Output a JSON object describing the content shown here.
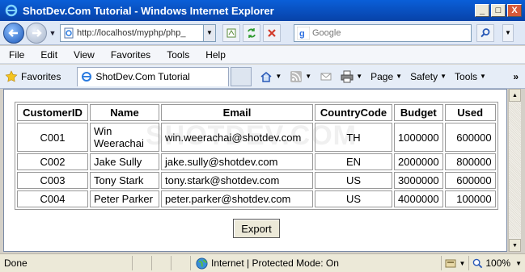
{
  "window": {
    "title": "ShotDev.Com Tutorial - Windows Internet Explorer",
    "controls": [
      "_",
      "□",
      "X"
    ]
  },
  "address": {
    "url": "http://localhost/myphp/php_",
    "search_placeholder": "Google"
  },
  "menu": [
    "File",
    "Edit",
    "View",
    "Favorites",
    "Tools",
    "Help"
  ],
  "command_bar": {
    "favorites_label": "Favorites",
    "tab_title": "ShotDev.Com Tutorial",
    "page_label": "Page",
    "safety_label": "Safety",
    "tools_label": "Tools",
    "more": "»"
  },
  "content": {
    "watermark": "SHOTDEV.COM",
    "table": {
      "headers": [
        "CustomerID",
        "Name",
        "Email",
        "CountryCode",
        "Budget",
        "Used"
      ],
      "rows": [
        [
          "C001",
          "Win Weerachai",
          "win.weerachai@shotdev.com",
          "TH",
          "1000000",
          "600000"
        ],
        [
          "C002",
          "Jake Sully",
          "jake.sully@shotdev.com",
          "EN",
          "2000000",
          "800000"
        ],
        [
          "C003",
          "Tony Stark",
          "tony.stark@shotdev.com",
          "US",
          "3000000",
          "600000"
        ],
        [
          "C004",
          "Peter Parker",
          "peter.parker@shotdev.com",
          "US",
          "4000000",
          "100000"
        ]
      ]
    },
    "export_label": "Export"
  },
  "status": {
    "text": "Done",
    "zone": "Internet | Protected Mode: On",
    "zoom": "100%"
  },
  "colors": {
    "titlebar": "#0a5fd8",
    "chrome_bg": "#dfe8f6",
    "status_bg": "#ece9d8"
  }
}
